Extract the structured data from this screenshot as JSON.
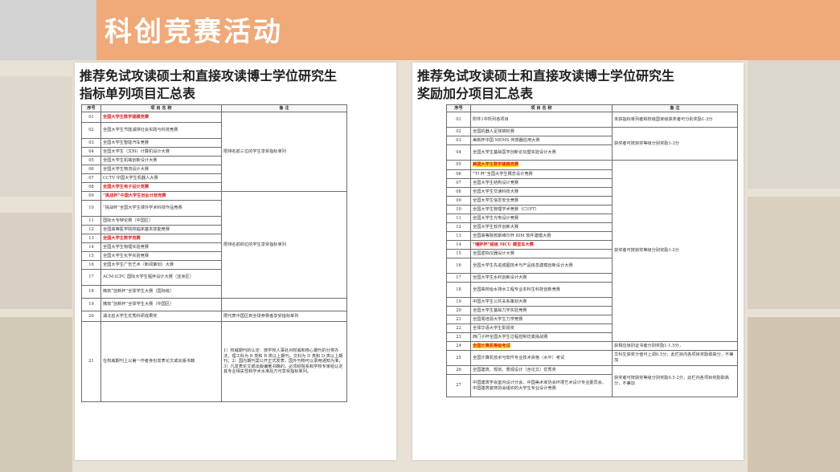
{
  "header": {
    "title": "科创竞赛活动"
  },
  "left_doc": {
    "title_line1": "推荐免试攻读硕士和直接攻读博士学位研究生",
    "title_line2": "指标单列项目汇总表",
    "headers": [
      "序号",
      "项 目 名 称",
      "备 注"
    ],
    "rows": [
      {
        "no": "01",
        "name": "全国大学生数学建模竞赛",
        "style": "red"
      },
      {
        "no": "02",
        "name": "全国大学生节能减排社会实践与科技竞赛",
        "style": ""
      },
      {
        "no": "03",
        "name": "全国大学生智能汽车竞赛",
        "style": ""
      },
      {
        "no": "04",
        "name": "全国大学生（文科）计算机设计大赛",
        "style": ""
      },
      {
        "no": "05",
        "name": "全国大学生机械创新设计大赛",
        "style": ""
      },
      {
        "no": "06",
        "name": "全国大学生物流设计大赛",
        "style": ""
      },
      {
        "no": "07",
        "name": "CCTV 中国大学生机器人大赛",
        "style": ""
      },
      {
        "no": "08",
        "name": "全国大学生电子设计竞赛",
        "style": "red"
      },
      {
        "no": "09",
        "name": "“挑战杯”中国大学生创业计划竞赛",
        "style": "red"
      },
      {
        "no": "10",
        "name": "“挑战杯”全国大学生课外学术科技作品竞赛",
        "style": ""
      },
      {
        "no": "11",
        "name": "国际大专辩论赛（中国区）",
        "style": ""
      },
      {
        "no": "12",
        "name": "全国高等医学院校临床基本技能竞赛",
        "style": ""
      },
      {
        "no": "13",
        "name": "全国大学生数学竞赛",
        "style": "red"
      },
      {
        "no": "14",
        "name": "全国大学生物理实验竞赛",
        "style": ""
      },
      {
        "no": "15",
        "name": "全国大学生化学实验竞赛",
        "style": ""
      },
      {
        "no": "16",
        "name": "全国大学生广告艺术（新闻策划）大赛",
        "style": ""
      },
      {
        "no": "17",
        "name": "ACM-ICPC 国际大学生程序设计大赛（亚洲区）",
        "style": ""
      },
      {
        "no": "18",
        "name": "微软“创新杯”全球学生大赛（国际级）",
        "style": ""
      },
      {
        "no": "19",
        "name": "微软“创新杯”全球学生大赛（中国区）",
        "style": ""
      },
      {
        "no": "20",
        "name": "湖北省大学生优秀科研成果奖",
        "style": ""
      },
      {
        "no": "21",
        "name": "在权威期刊上以第一作者身份发表论文或出版书籍",
        "style": ""
      }
    ],
    "notes": {
      "group1": "限排名前三位的学生享受指标单列",
      "group2": "限排名前四位的学生享受指标单列",
      "row19": "限代表中国区到全球参赛者享受指标单列",
      "row21": "1）权威期刊的认定：按学校人事处对权威和核心期刊的分类办法，理工科为 B 类和 B 类以上期刊，文科为 D 类和 D 类以上期刊；2）国内期刊需公开正式发表，国外刊物可以录用通知为准；3）凡发表论文或出版编著书籍的，必须经院系和学校专家组认定其专业相关性和学术水准后方可享受指标单列。"
    }
  },
  "right_doc": {
    "title_line1": "推荐免试攻读硕士和直接攻读博士学位研究生",
    "title_line2": "奖励加分项目汇总表",
    "headers": [
      "序号",
      "项 目 名 称",
      "备 注"
    ],
    "rows": [
      {
        "no": "01",
        "name": "附件1中所列各项目",
        "style": ""
      },
      {
        "no": "02",
        "name": "全国机器人足球锦标赛",
        "style": ""
      },
      {
        "no": "03",
        "name": "美新杯中国 MEMS 传感器应用大赛",
        "style": ""
      },
      {
        "no": "04",
        "name": "全国大学生基础医学创新论坛暨实验设计大赛",
        "style": ""
      },
      {
        "no": "05",
        "name": "美国大学生数学建模竞赛",
        "style": "hl"
      },
      {
        "no": "06",
        "name": "“TI 杯”全国大学生概念设计竞赛",
        "style": ""
      },
      {
        "no": "07",
        "name": "全国大学生结构设计竞赛",
        "style": ""
      },
      {
        "no": "08",
        "name": "全国大学生交通科技大赛",
        "style": ""
      },
      {
        "no": "09",
        "name": "全国大学生信息安全竞赛",
        "style": ""
      },
      {
        "no": "10",
        "name": "全国大学生物理学术竞赛（CUPT）",
        "style": ""
      },
      {
        "no": "11",
        "name": "全国大学生光电设计竞赛",
        "style": ""
      },
      {
        "no": "12",
        "name": "全国大学生软件创新大赛",
        "style": ""
      },
      {
        "no": "13",
        "name": "全国高等院校斯维尔杯 BIM 软件建模大赛",
        "style": ""
      },
      {
        "no": "14",
        "name": "“瑞萨杯”超级 MCU 模型车大赛",
        "style": "red"
      },
      {
        "no": "15",
        "name": "全国虚拟仪器设计大赛",
        "style": ""
      },
      {
        "no": "16",
        "name": "全国大学生先进成图技术与产品信息建模创新设计大赛",
        "style": ""
      },
      {
        "no": "17",
        "name": "全国大学生水利创新设计大赛",
        "style": ""
      },
      {
        "no": "18",
        "name": "全国高校给水排水工程专业本科生科技创新竞赛",
        "style": ""
      },
      {
        "no": "19",
        "name": "中国大学生公共关系策划大赛",
        "style": ""
      },
      {
        "no": "20",
        "name": "全国大学生基础力学实验竞赛",
        "style": ""
      },
      {
        "no": "21",
        "name": "全国周培源大学生力学竞赛",
        "style": ""
      },
      {
        "no": "22",
        "name": "全球华语大学生影视奖",
        "style": ""
      },
      {
        "no": "23",
        "name": "西门子杯全国大学生过程控制仿真挑战赛",
        "style": ""
      },
      {
        "no": "24",
        "name": "全国计算机等级考试",
        "style": "hl"
      },
      {
        "no": "25",
        "name": "全国计算机技术与软件专业技术资格（水平）考试",
        "style": ""
      },
      {
        "no": "26",
        "name": "全国建筑、规划、景观设计（含论文）优秀奖",
        "style": ""
      },
      {
        "no": "27",
        "name": "中国建筑学会室内设计分会、中国美术家协会环境艺术设计专业委员会、中国建筑装饰协会组织的大学生专业设计竞赛",
        "style": ""
      }
    ],
    "notes": {
      "row01": "未获指标单列者和校级国家级获奖者可分别奖励1-3分",
      "g2_4": "获奖者可按获奖等级分别奖励1-3分",
      "g5_23": "获奖者可按获奖等级分别奖励1-2分",
      "row24": "获相应级别证书者分别奖励1-1.5分，",
      "row25": "文科生获奖分值可上调0.5分；此栏目内各项目奖励取高分，不兼加",
      "g26_27": "获奖者可按获奖等级分别奖励0.5-2分，此栏内各项目奖励取高分，不兼加"
    }
  }
}
